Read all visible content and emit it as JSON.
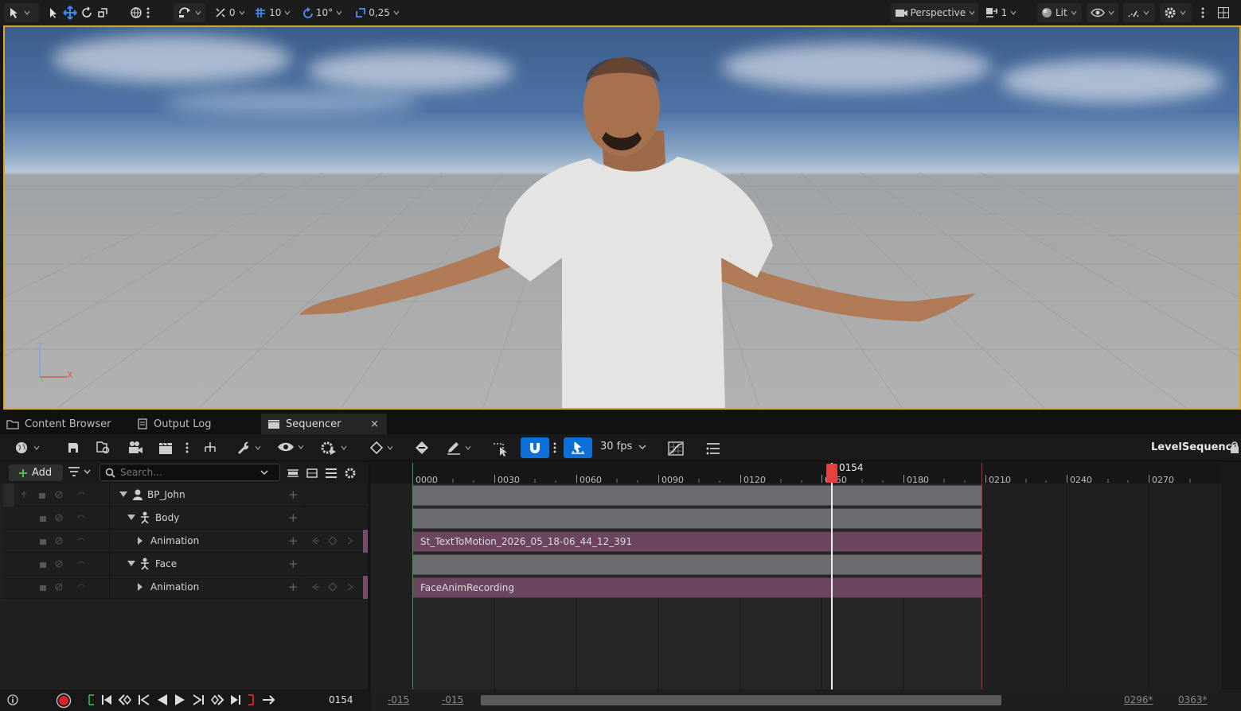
{
  "viewport_toolbar": {
    "translate_snap": "0",
    "grid_snap": "10",
    "rotate_snap": "10°",
    "scale_snap": "0,25",
    "view_mode": "Perspective",
    "camera_speed": "1",
    "lighting_mode": "Lit"
  },
  "viewport": {
    "axis_z": "Z",
    "axis_x": "X"
  },
  "tabs": [
    {
      "label": "Content Browser"
    },
    {
      "label": "Output Log"
    },
    {
      "label": "Sequencer"
    }
  ],
  "sequencer_toolbar": {
    "fps": "30 fps",
    "sequence_name": "LevelSequence"
  },
  "outliner": {
    "add_label": "Add",
    "search_placeholder": "Search...",
    "rows": [
      {
        "label": "BP_John"
      },
      {
        "label": "Body"
      },
      {
        "label": "Animation"
      },
      {
        "label": "Face"
      },
      {
        "label": "Animation"
      }
    ]
  },
  "timeline": {
    "ticks": [
      "0000",
      "0030",
      "0060",
      "0090",
      "0120",
      "0150",
      "0180",
      "0210",
      "0240",
      "0270"
    ],
    "playhead": "0154",
    "sections": [
      {
        "label": "St_TextToMotion_2026_05_18-06_44_12_391"
      },
      {
        "label": "FaceAnimRecording"
      }
    ]
  },
  "transport": {
    "current_frame": "0154",
    "view_start": "-015",
    "working_start": "-015",
    "working_end": "0296*",
    "view_end": "0363*"
  },
  "colors": {
    "accent_blue": "#0e6fd8",
    "selection_outline": "#d9a62a",
    "anim_section": "#6c4560",
    "playhead": "#e84040"
  }
}
